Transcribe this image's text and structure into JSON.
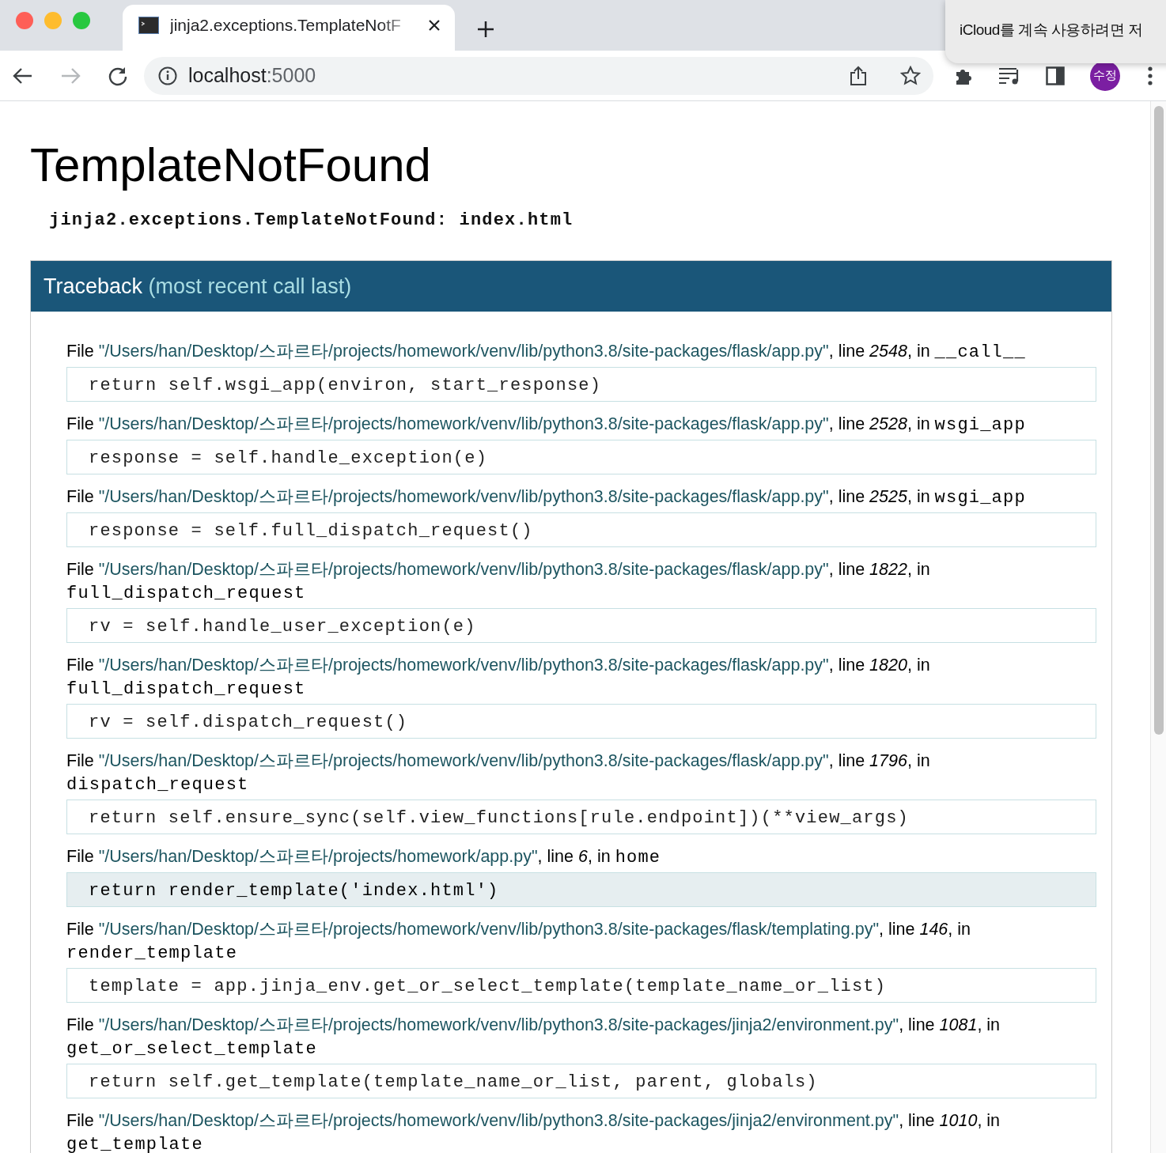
{
  "browser": {
    "tab": {
      "title": "jinja2.exceptions.TemplateNotF",
      "selected": true
    },
    "address": {
      "host": "localhost",
      "port": ":5000"
    },
    "profile": "수정"
  },
  "notification": {
    "message": "iCloud를 계속 사용하려면 저"
  },
  "page": {
    "title": "TemplateNotFound",
    "exception": "jinja2.exceptions.TemplateNotFound: index.html",
    "traceback_title": "Traceback",
    "traceback_note": "(most recent call last)",
    "frames": [
      {
        "file_word": "File",
        "path": "\"/Users/han/Desktop/스파르타/projects/homework/venv/lib/python3.8/site-packages/flask/app.py\"",
        "line_word": ", line",
        "line": "2548",
        "in_word": ", in",
        "function": "__call__",
        "code": "return self.wsgi_app(environ, start_response)",
        "highlighted": false
      },
      {
        "file_word": "File",
        "path": "\"/Users/han/Desktop/스파르타/projects/homework/venv/lib/python3.8/site-packages/flask/app.py\"",
        "line_word": ", line",
        "line": "2528",
        "in_word": ", in",
        "function": "wsgi_app",
        "code": "response = self.handle_exception(e)",
        "highlighted": false
      },
      {
        "file_word": "File",
        "path": "\"/Users/han/Desktop/스파르타/projects/homework/venv/lib/python3.8/site-packages/flask/app.py\"",
        "line_word": ", line",
        "line": "2525",
        "in_word": ", in",
        "function": "wsgi_app",
        "code": "response = self.full_dispatch_request()",
        "highlighted": false
      },
      {
        "file_word": "File",
        "path": "\"/Users/han/Desktop/스파르타/projects/homework/venv/lib/python3.8/site-packages/flask/app.py\"",
        "line_word": ", line",
        "line": "1822",
        "in_word": ", in",
        "function": "full_dispatch_request",
        "code": "rv = self.handle_user_exception(e)",
        "highlighted": false
      },
      {
        "file_word": "File",
        "path": "\"/Users/han/Desktop/스파르타/projects/homework/venv/lib/python3.8/site-packages/flask/app.py\"",
        "line_word": ", line",
        "line": "1820",
        "in_word": ", in",
        "function": "full_dispatch_request",
        "code": "rv = self.dispatch_request()",
        "highlighted": false
      },
      {
        "file_word": "File",
        "path": "\"/Users/han/Desktop/스파르타/projects/homework/venv/lib/python3.8/site-packages/flask/app.py\"",
        "line_word": ", line",
        "line": "1796",
        "in_word": ", in",
        "function": "dispatch_request",
        "code": "return self.ensure_sync(self.view_functions[rule.endpoint])(**view_args)",
        "highlighted": false
      },
      {
        "file_word": "File",
        "path": "\"/Users/han/Desktop/스파르타/projects/homework/app.py\"",
        "line_word": ", line",
        "line": "6",
        "in_word": ", in",
        "function": "home",
        "code": "return render_template('index.html')",
        "highlighted": true
      },
      {
        "file_word": "File",
        "path": "\"/Users/han/Desktop/스파르타/projects/homework/venv/lib/python3.8/site-packages/flask/templating.py\"",
        "line_word": ", line",
        "line": "146",
        "in_word": ", in",
        "function": "render_template",
        "code": "template = app.jinja_env.get_or_select_template(template_name_or_list)",
        "highlighted": false
      },
      {
        "file_word": "File",
        "path": "\"/Users/han/Desktop/스파르타/projects/homework/venv/lib/python3.8/site-packages/jinja2/environment.py\"",
        "line_word": ", line",
        "line": "1081",
        "in_word": ", in",
        "function": "get_or_select_template",
        "code": "return self.get_template(template_name_or_list, parent, globals)",
        "highlighted": false
      },
      {
        "file_word": "File",
        "path": "\"/Users/han/Desktop/스파르타/projects/homework/venv/lib/python3.8/site-packages/jinja2/environment.py\"",
        "line_word": ", line",
        "line": "1010",
        "in_word": ", in",
        "function": "get_template"
      }
    ]
  }
}
